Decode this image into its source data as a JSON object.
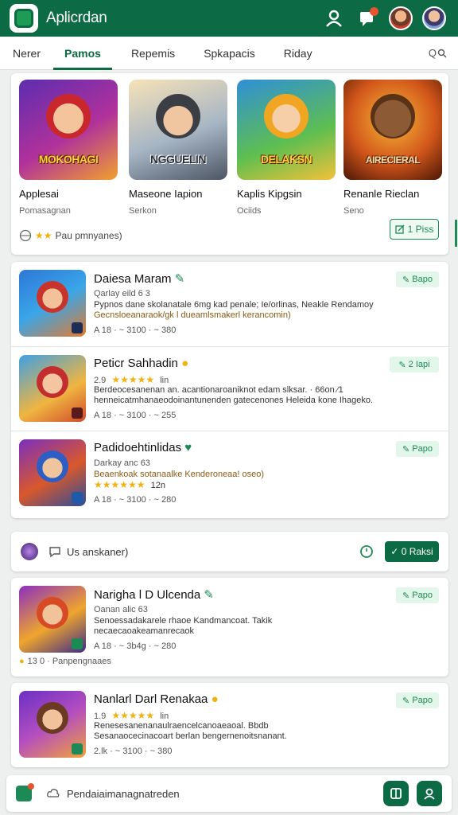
{
  "header": {
    "title": "Aplicrdan"
  },
  "tabs": [
    {
      "label": "Nerer"
    },
    {
      "label": "Pamos"
    },
    {
      "label": "Repemis"
    },
    {
      "label": "Spkapacis"
    },
    {
      "label": "Riday"
    }
  ],
  "search_hint": "Q",
  "featured": {
    "items": [
      {
        "caption": "MOKOHAGI",
        "name": "Applesai",
        "sub": "Pomasagnan"
      },
      {
        "caption": "NGGUELIN",
        "name": "Maseone Iapion",
        "sub": "Serkon"
      },
      {
        "caption": "DELAKSN",
        "name": "Kaplis Kipgsin",
        "sub": "Ociids"
      },
      {
        "caption": "AIRECIERAL",
        "name": "Renanle Rieclan",
        "sub": "Seno"
      }
    ],
    "rating_label": "Pau pmnyanes)",
    "button_label": "1 Piss"
  },
  "list1": [
    {
      "title": "Daiesa Maram",
      "meta": "Qarlay eild 6 3",
      "desc_line1": "Pypnos dane skolanatale 6mg kad penale; Ie/orlinas, Neakle Rendamoy",
      "desc_line2": "Gecnsloeanaraok/gk l dueamlsmakerl kerancomin)",
      "stats": "A 18 · ~ 3100 · ~ 380",
      "pill": "Bapo"
    },
    {
      "title": "Peticr Sahhadin",
      "meta": "2.9",
      "rating_suffix": "lin",
      "desc_line1": "Berdeocesanenan an. acantionaroaniknot edam slksar. · 66on ⁄1",
      "desc_line2": "henneicatmhanaeodoinantunenden gatecenones Heleida kone Ihageko.",
      "stats": "A 18 · ~ 3100 · ~ 255",
      "pill": "2 Iapi"
    },
    {
      "title": "Padidoehtinlidas",
      "meta": "Darkay anc 63",
      "desc_line1": "Beaenkoak sotanaalke Kenderoneaa! oseo)",
      "desc_line2": "",
      "rating_suffix": "12n",
      "stats": "A 18 · ~ 3100 · ~ 280",
      "pill": "Papo"
    }
  ],
  "share_bar": {
    "label": "Us anskaner)",
    "button": "0 Raksi"
  },
  "list2": [
    {
      "title": "Narigha l D Ulcenda",
      "meta": "Oanan alic 63",
      "desc_line1": "Senoessadakarele rhaoe Kandmancoat. Takik",
      "desc_line2": "necaecaoakeamanrecaok",
      "stats": "A 18 · ~ 3b4g · ~ 280",
      "pill": "Papo",
      "footer": "13 0 · Panpengnaaes"
    },
    {
      "title": "Nanlarl Darl Renakaa",
      "meta": "1.9",
      "rating_suffix": "lin",
      "desc_line1": "Renesesanenanaulraencelcanoaeaoal. Bbdb",
      "desc_line2": "Sesanaocecinacoart berlan bengernenoitsnanant.",
      "stats": "2.lk · ~ 3100 · ~ 380",
      "pill": "Papo"
    }
  ],
  "bottom_bar": {
    "label": "Pendaiaimanagnatreden"
  },
  "colors": {
    "brand": "#0c6a45",
    "accent": "#1d8a55",
    "star": "#f2b10c"
  },
  "icons": [
    "user-icon",
    "chat-icon",
    "search-icon",
    "star-icon",
    "edit-icon",
    "plus-icon",
    "grid-icon",
    "profile-icon"
  ]
}
